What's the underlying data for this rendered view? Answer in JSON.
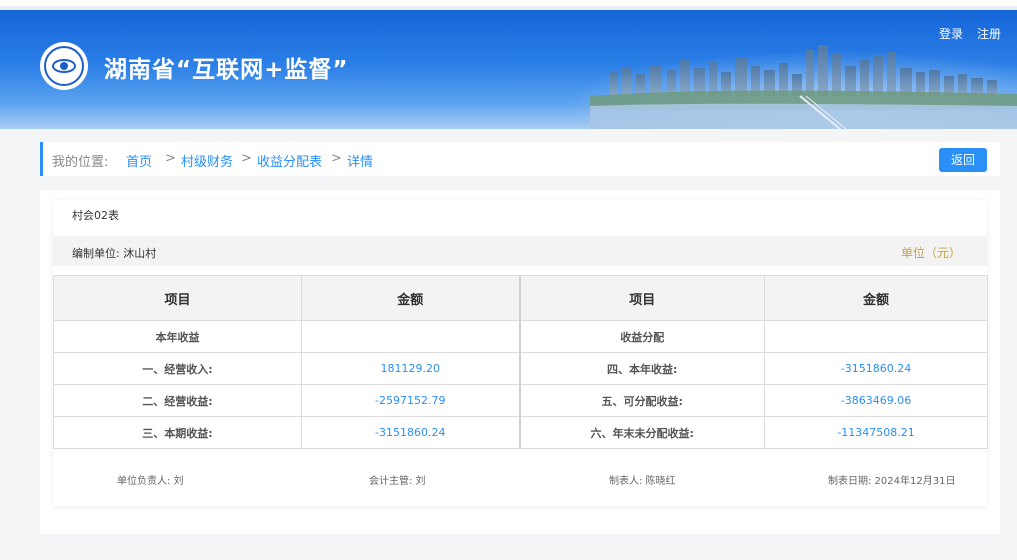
{
  "header": {
    "site_title": "湖南省“互联网+监督”",
    "login_label": "登录",
    "register_label": "注册"
  },
  "breadcrumb": {
    "prefix": "我的位置:",
    "items": [
      "首页",
      "村级财务",
      "收益分配表",
      "详情"
    ],
    "separator": ">"
  },
  "back_label": "返回",
  "report": {
    "form_no": "村会02表",
    "unit": "编制单位:  沐山村",
    "currency": "单位（元）",
    "headers": [
      "项目",
      "金额",
      "项目",
      "金额"
    ],
    "rows": [
      {
        "l_item": "本年收益",
        "l_amt": "",
        "r_item": "收益分配",
        "r_amt": ""
      },
      {
        "l_item": "一、经营收入:",
        "l_amt": "181129.20",
        "r_item": "四、本年收益:",
        "r_amt": "-3151860.24"
      },
      {
        "l_item": "二、经营收益:",
        "l_amt": "-2597152.79",
        "r_item": "五、可分配收益:",
        "r_amt": "-3863469.06"
      },
      {
        "l_item": "三、本期收益:",
        "l_amt": "-3151860.24",
        "r_item": "六、年末未分配收益:",
        "r_amt": "-11347508.21"
      }
    ],
    "signatures": {
      "head": "单位负责人:  刘",
      "accountant": "会计主管:  刘",
      "preparer": "制表人:  陈晓红",
      "date": "制表日期:  2024年12月31日"
    }
  }
}
